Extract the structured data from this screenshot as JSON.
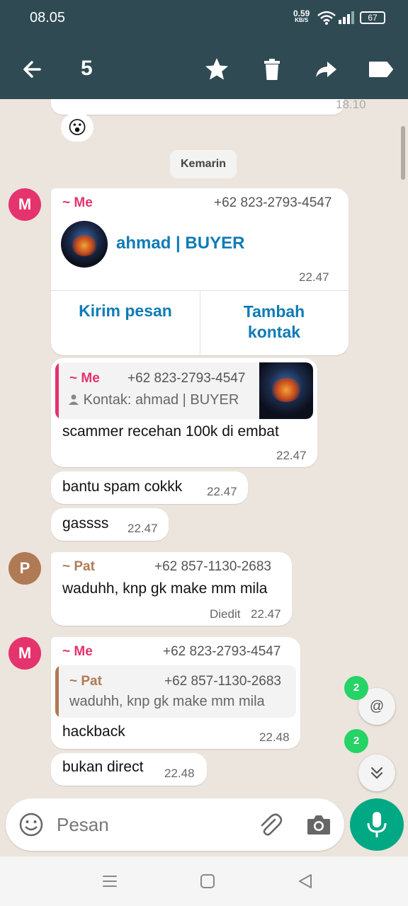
{
  "status": {
    "time": "08.05",
    "net_speed": "0.59",
    "net_unit": "KB/S",
    "battery": "67"
  },
  "actionbar": {
    "selected_count": "5"
  },
  "chat": {
    "top_bubble_time": "18.10",
    "reaction": "😮",
    "date_chip": "Kemarin",
    "contact_card": {
      "sender": "~ Me",
      "phone": "+62 823-2793-4547",
      "contact_name": "ahmad | BUYER",
      "time": "22.47",
      "btn_message": "Kirim pesan",
      "btn_add_1": "Tambah",
      "btn_add_2": "kontak"
    },
    "reply1": {
      "quote_sender": "~ Me",
      "quote_phone": "+62 823-2793-4547",
      "quote_text": "Kontak: ahmad | BUYER",
      "text": "scammer recehan 100k di embat",
      "time": "22.47"
    },
    "msg_spam": {
      "text": "bantu spam cokkk",
      "time": "22.47"
    },
    "msg_gas": {
      "text": "gassss",
      "time": "22.47"
    },
    "pat_msg": {
      "avatar": "P",
      "sender": "~ Pat",
      "phone": "+62 857-1130-2683",
      "text": "waduhh, knp gk make mm mila",
      "edited": "Diedit",
      "time": "22.47"
    },
    "me_reply": {
      "avatar": "M",
      "sender": "~ Me",
      "phone": "+62 823-2793-4547",
      "quote_sender": "~ Pat",
      "quote_phone": "+62 857-1130-2683",
      "quote_text": "waduhh, knp gk make mm mila",
      "text": "hackback",
      "time": "22.48"
    },
    "msg_direct": {
      "text": "bukan direct",
      "time": "22.48"
    },
    "mention_badge": "2",
    "mention_symbol": "@",
    "scroll_badge": "2"
  },
  "input": {
    "placeholder": "Pesan"
  },
  "colors": {
    "header": "#2f4a53",
    "me": "#e5336d",
    "pat": "#b07a55",
    "link": "#0f7bb5",
    "accent": "#00a884"
  }
}
